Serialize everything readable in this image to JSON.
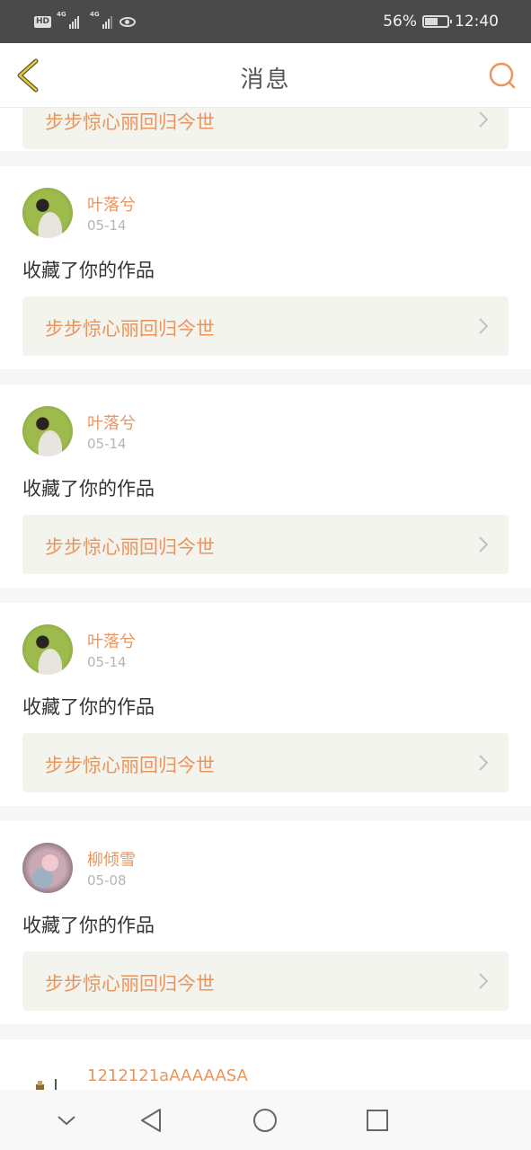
{
  "status_bar": {
    "hd": "HD",
    "net1": "4G",
    "net2": "4G",
    "battery": "56%",
    "time": "12:40"
  },
  "header": {
    "title": "消息",
    "back_icon": "chevron-left-icon",
    "search_icon": "search-icon"
  },
  "partial_top": {
    "work_title": "步步惊心丽回归今世"
  },
  "messages": [
    {
      "user": "叶落兮",
      "date": "05-14",
      "action": "收藏了你的作品",
      "work_title": "步步惊心丽回归今世",
      "avatar": "avatar-a"
    },
    {
      "user": "叶落兮",
      "date": "05-14",
      "action": "收藏了你的作品",
      "work_title": "步步惊心丽回归今世",
      "avatar": "avatar-a"
    },
    {
      "user": "叶落兮",
      "date": "05-14",
      "action": "收藏了你的作品",
      "work_title": "步步惊心丽回归今世",
      "avatar": "avatar-a"
    },
    {
      "user": "柳倾雪",
      "date": "05-08",
      "action": "收藏了你的作品",
      "work_title": "步步惊心丽回归今世",
      "avatar": "avatar-b"
    }
  ],
  "partial_bottom": {
    "user": "1212121aAAAAASA"
  },
  "colors": {
    "accent": "#e8955f",
    "status_bar_bg": "#4a4a4a",
    "card_link_bg": "#f4f4ee",
    "back_icon": "#e8c93a"
  },
  "system_nav": {
    "icons": [
      "chevron-down-icon",
      "back-triangle-icon",
      "home-circle-icon",
      "recents-square-icon"
    ]
  }
}
